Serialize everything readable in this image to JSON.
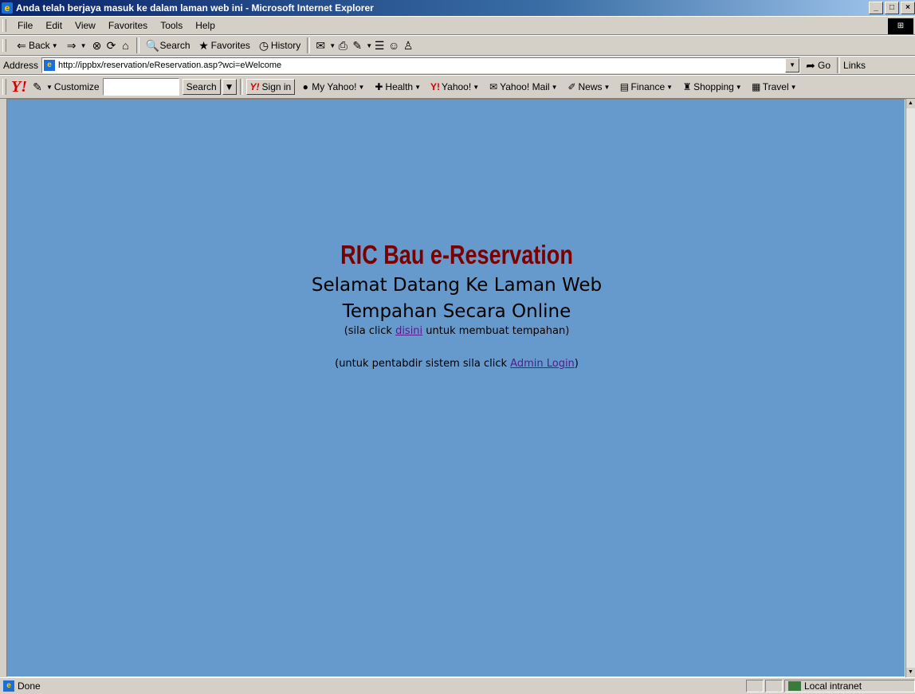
{
  "window": {
    "title": "Anda telah berjaya masuk ke dalam laman web ini - Microsoft Internet Explorer",
    "controls": [
      "_",
      "□",
      "×"
    ]
  },
  "menu": [
    "File",
    "Edit",
    "View",
    "Favorites",
    "Tools",
    "Help"
  ],
  "toolbar": {
    "back": "Back",
    "search": "Search",
    "favorites": "Favorites",
    "history": "History"
  },
  "address": {
    "label": "Address",
    "url": "http://ippbx/reservation/eReservation.asp?wci=eWelcome",
    "go": "Go",
    "links": "Links"
  },
  "yahoo": {
    "logo": "Y!",
    "customize": "Customize",
    "search_button": "Search",
    "sign_in": "Sign in",
    "items": [
      "My Yahoo!",
      "Health",
      "Yahoo!",
      "Yahoo! Mail",
      "News",
      "Finance",
      "Shopping",
      "Travel"
    ]
  },
  "page": {
    "title": "RIC Bau e-Reservation",
    "welcome_line1": "Selamat Datang Ke Laman Web",
    "welcome_line2": "Tempahan Secara Online",
    "click_prefix": "(sila click ",
    "click_link": "disini",
    "click_suffix": " untuk membuat tempahan)",
    "admin_prefix": "(untuk pentabdir sistem sila click ",
    "admin_link": "Admin Login",
    "admin_suffix": ")",
    "background_color": "#6699cc",
    "title_color": "#7a0000"
  },
  "status": {
    "text": "Done",
    "zone": "Local intranet"
  }
}
